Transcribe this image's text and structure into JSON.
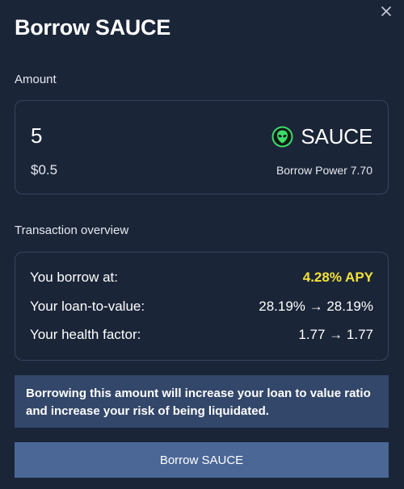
{
  "modal": {
    "title": "Borrow SAUCE",
    "close_icon": "close-icon"
  },
  "amount": {
    "label": "Amount",
    "value": "5",
    "usd_value": "$0.5",
    "token_symbol": "SAUCE",
    "token_icon": "sauce-alien-icon",
    "borrow_power": "Borrow Power 7.70"
  },
  "overview": {
    "label": "Transaction overview",
    "rows": [
      {
        "label": "You borrow at:",
        "value": "4.28% APY"
      },
      {
        "label": "Your loan-to-value:",
        "value": "28.19% → 28.19%"
      },
      {
        "label": "Your health factor:",
        "value": "1.77 → 1.77"
      }
    ]
  },
  "warning": {
    "text": "Borrowing this amount will increase your loan to value ratio and increase your risk of being liquidated."
  },
  "action": {
    "button_label": "Borrow SAUCE"
  },
  "colors": {
    "background": "#1b2538",
    "border": "#34445e",
    "apy_accent": "#f3e23a",
    "token_green": "#3ddc6c",
    "warning_bg": "#33476a",
    "button_bg": "#4a6796"
  }
}
